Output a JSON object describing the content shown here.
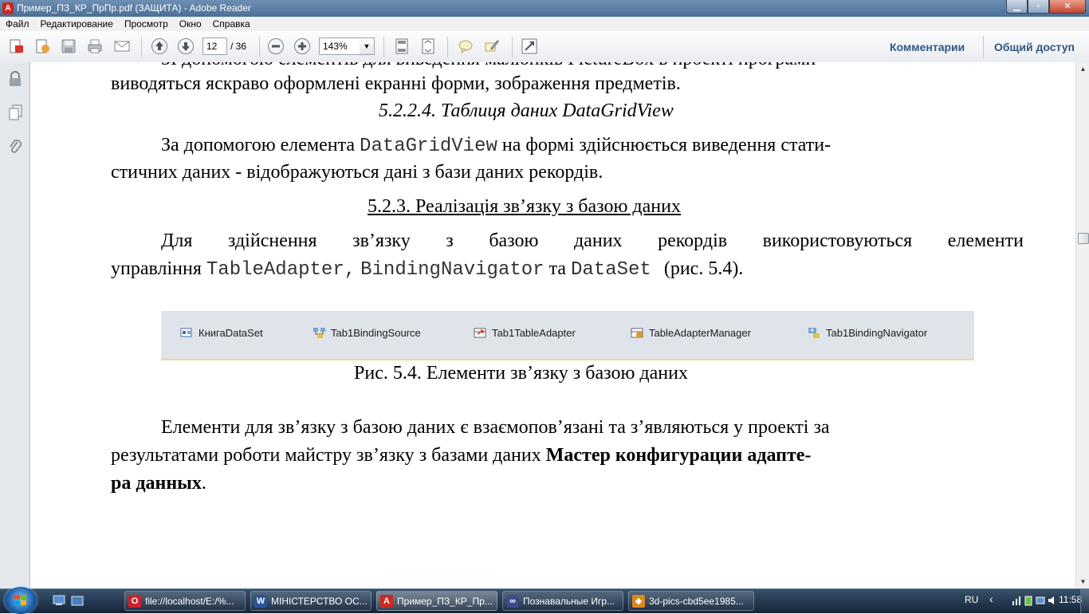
{
  "window": {
    "title": "Пример_ПЗ_КР_ПрПр.pdf (ЗАЩИТА) - Adobe Reader",
    "minimize_glyph": "▁",
    "maximize_glyph": "▫",
    "close_glyph": "✕"
  },
  "menu": [
    "Файл",
    "Редактирование",
    "Просмотр",
    "Окно",
    "Справка"
  ],
  "toolbar": {
    "page_current": "12",
    "page_total": "/ 36",
    "zoom_value": "143%",
    "zoom_arrow": "▼",
    "comments_link": "Комментарии",
    "share_link": "Общий доступ"
  },
  "document": {
    "line_top_partial": "ЗІ допомогою елементів для виведення малюнків PictureBox в проекті програми",
    "line1": "виводяться яскраво оформлені екранні форми, зображення предметів.",
    "heading_5224": "5.2.2.4. Таблиця даних DataGridView",
    "p1_start": "За допомогою елемента",
    "p1_code": "DataGridView",
    "p1_end": "на формі здійснюється виведення стати-",
    "p1_line2": "стичних даних - відображуються дані з бази даних рекордів.",
    "heading_523": "5.2.3. Реалізація зв’язку з базою даних",
    "p2_words": [
      "Для",
      "здійснення",
      "зв’язку",
      "з",
      "базою",
      "даних",
      "рекордів",
      "використовуються",
      "елементи"
    ],
    "p2_line2_start": "управління",
    "p2_code1": "TableAdapter,",
    "p2_code2": "BindingNavigator",
    "p2_mid": "та",
    "p2_code3": "DataSet",
    "p2_end": "(рис. 5.4).",
    "figure_caption": "Рис. 5.4. Елементи зв’язку з базою даних",
    "p3_line1": "Елементи для зв’язку з базою даних є взаємопов’язані та з’являються у проекті за",
    "p3_line2_start": "результатами роботи майстру зв’язку з базами даних",
    "p3_line2_bold": "Мастер конфигурации адапте-",
    "p3_line3_bold": "ра данных",
    "p3_line3_end": "."
  },
  "figure_components": [
    {
      "label": "КнигаDataSet",
      "icon": "dataset-icon"
    },
    {
      "label": "Tab1BindingSource",
      "icon": "binding-source-icon"
    },
    {
      "label": "Tab1TableAdapter",
      "icon": "table-adapter-icon"
    },
    {
      "label": "TableAdapterManager",
      "icon": "table-adapter-manager-icon"
    },
    {
      "label": "Tab1BindingNavigator",
      "icon": "binding-navigator-icon"
    }
  ],
  "taskbar": {
    "tasks": [
      {
        "label": "file://localhost/E:/%...",
        "icon": "opera-icon",
        "color": "#d0202a",
        "glyph": "O"
      },
      {
        "label": "МІНІСТЕРСТВО ОС...",
        "icon": "word-icon",
        "color": "#2a5599",
        "glyph": "W"
      },
      {
        "label": "Пример_ПЗ_КР_Пр...",
        "icon": "adobe-reader-icon",
        "color": "#c92a20",
        "glyph": "A"
      },
      {
        "label": "Познавальные Игр...",
        "icon": "browser-icon",
        "color": "#3c4a8a",
        "glyph": "∞"
      },
      {
        "label": "3d-pics-cbd5ee1985...",
        "icon": "image-viewer-icon",
        "color": "#d9891c",
        "glyph": "◆"
      }
    ],
    "language": "RU",
    "tray_chevron": "‹",
    "clock": "11:58"
  }
}
